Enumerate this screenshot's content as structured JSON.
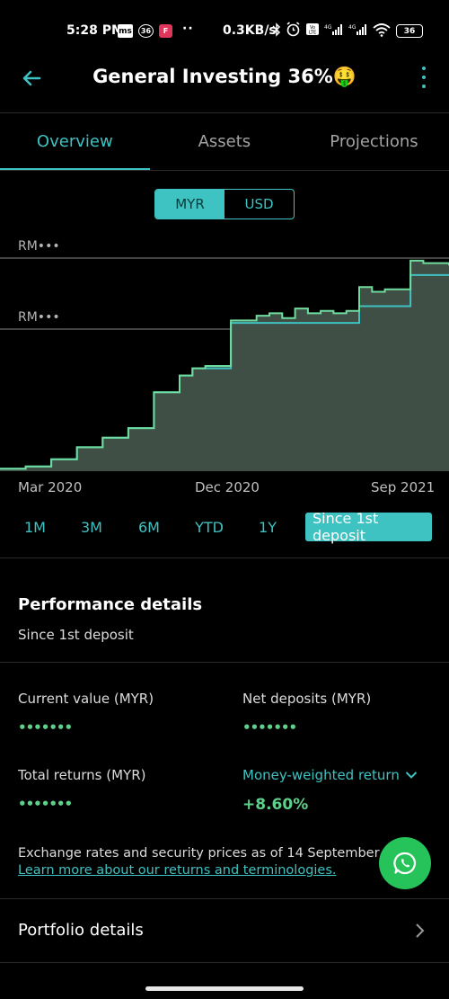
{
  "status_bar": {
    "time": "5:28 PM",
    "ms_badge": "ms",
    "circle_badge": "36",
    "app_badge": "F",
    "dots": "··",
    "speed": "0.3KB/s",
    "icon_names": [
      "bluetooth-icon",
      "alarm-icon",
      "volte-icon",
      "signal-icon",
      "signal-icon",
      "wifi-icon"
    ],
    "battery": "36"
  },
  "app_bar": {
    "title": "General Investing 36%🤑"
  },
  "tabs": [
    {
      "label": "Overview",
      "active": true
    },
    {
      "label": "Assets",
      "active": false
    },
    {
      "label": "Projections",
      "active": false
    }
  ],
  "currency": {
    "options": [
      "MYR",
      "USD"
    ],
    "selected": "MYR"
  },
  "chart": {
    "y_labels": [
      "RM•••",
      "RM•••"
    ],
    "x_labels": [
      "Mar 2020",
      "Dec 2020",
      "Sep 2021"
    ],
    "colors": {
      "value_line": "#6fdc9e",
      "deposit_line": "#3fc2c2",
      "fill": "#3f4f46"
    }
  },
  "chart_data": {
    "type": "area",
    "x_labels": [
      "Mar 2020",
      "Dec 2020",
      "Sep 2021"
    ],
    "y_labels": [
      "RM•••",
      "RM•••"
    ],
    "series": [
      {
        "name": "",
        "values": [
          0.01,
          0.01,
          0.02,
          0.02,
          0.05,
          0.05,
          0.1,
          0.1,
          0.14,
          0.14,
          0.18,
          0.18,
          0.33,
          0.33,
          0.4,
          0.43,
          0.44,
          0.44,
          0.63,
          0.63,
          0.65,
          0.66,
          0.64,
          0.68,
          0.66,
          0.67,
          0.66,
          0.67,
          0.77,
          0.75,
          0.76,
          0.76,
          0.88,
          0.87,
          0.87,
          0.86
        ]
      },
      {
        "name": "",
        "values": [
          0.01,
          0.01,
          0.02,
          0.02,
          0.05,
          0.05,
          0.1,
          0.1,
          0.14,
          0.14,
          0.18,
          0.18,
          0.33,
          0.33,
          0.4,
          0.43,
          0.43,
          0.43,
          0.62,
          0.62,
          0.62,
          0.62,
          0.62,
          0.62,
          0.62,
          0.62,
          0.62,
          0.62,
          0.69,
          0.69,
          0.69,
          0.69,
          0.82,
          0.82,
          0.82,
          0.82
        ]
      }
    ]
  },
  "ranges": [
    {
      "label": "1M",
      "active": false
    },
    {
      "label": "3M",
      "active": false
    },
    {
      "label": "6M",
      "active": false
    },
    {
      "label": "YTD",
      "active": false
    },
    {
      "label": "1Y",
      "active": false
    },
    {
      "label": "Since 1st deposit",
      "active": true
    }
  ],
  "performance": {
    "title": "Performance details",
    "subtitle": "Since 1st deposit",
    "current_value_label": "Current value (MYR)",
    "current_value": "•••••••",
    "net_deposits_label": "Net deposits (MYR)",
    "net_deposits": "•••••••",
    "total_returns_label": "Total returns (MYR)",
    "total_returns": "•••••••",
    "mwr_label": "Money-weighted return",
    "mwr_value": "+8.60%"
  },
  "footnote": {
    "text": "Exchange rates and security prices as of 14 September",
    "link": "Learn more about our returns and terminologies."
  },
  "portfolio": {
    "label": "Portfolio details"
  }
}
